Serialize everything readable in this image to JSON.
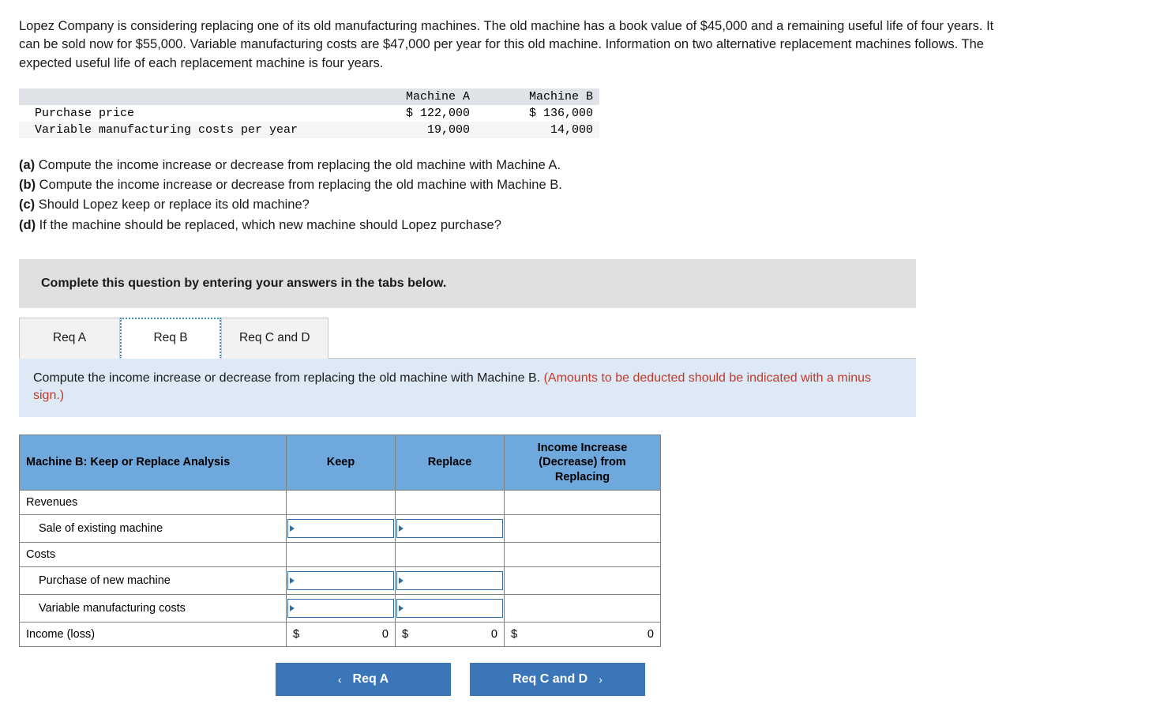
{
  "problem": {
    "text": "Lopez Company is considering replacing one of its old manufacturing machines. The old machine has a book value of $45,000 and a remaining useful life of four years. It can be sold now for $55,000. Variable manufacturing costs are $47,000 per year for this old machine. Information on two alternative replacement machines follows. The expected useful life of each replacement machine is four years."
  },
  "data_table": {
    "headers": [
      "",
      "Machine A",
      "Machine B"
    ],
    "rows": [
      {
        "label": "Purchase price",
        "machine_a": "$ 122,000",
        "machine_b": "$ 136,000"
      },
      {
        "label": "Variable manufacturing costs per year",
        "machine_a": "19,000",
        "machine_b": "14,000"
      }
    ]
  },
  "requirements": [
    {
      "letter": "(a)",
      "text": "Compute the income increase or decrease from replacing the old machine with Machine A."
    },
    {
      "letter": "(b)",
      "text": "Compute the income increase or decrease from replacing the old machine with Machine B."
    },
    {
      "letter": "(c)",
      "text": "Should Lopez keep or replace its old machine?"
    },
    {
      "letter": "(d)",
      "text": "If the machine should be replaced, which new machine should Lopez purchase?"
    }
  ],
  "banner": {
    "text": "Complete this question by entering your answers in the tabs below."
  },
  "tabs": [
    {
      "label": "Req A",
      "active": false
    },
    {
      "label": "Req B",
      "active": true
    },
    {
      "label": "Req C and D",
      "active": false
    }
  ],
  "instruction": {
    "main": "Compute the income increase or decrease from replacing the old machine with Machine B.",
    "note": "(Amounts to be deducted should be indicated with a minus sign.)"
  },
  "worksheet": {
    "headers": {
      "analysis": "Machine B: Keep or Replace Analysis",
      "keep": "Keep",
      "replace": "Replace",
      "income": "Income Increase (Decrease) from Replacing"
    },
    "rows": [
      {
        "label": "Revenues",
        "indent": false,
        "type": "section"
      },
      {
        "label": "Sale of existing machine",
        "indent": true,
        "type": "input"
      },
      {
        "label": "Costs",
        "indent": false,
        "type": "section"
      },
      {
        "label": "Purchase of new machine",
        "indent": true,
        "type": "input"
      },
      {
        "label": "Variable manufacturing costs",
        "indent": true,
        "type": "input"
      }
    ],
    "total_row": {
      "label": "Income (loss)",
      "keep_symbol": "$",
      "keep_value": "0",
      "replace_symbol": "$",
      "replace_value": "0",
      "income_symbol": "$",
      "income_value": "0"
    }
  },
  "nav": {
    "prev_label": "Req A",
    "prev_icon": "‹",
    "next_label": "Req C and D",
    "next_icon": "›"
  },
  "colors": {
    "header_blue": "#6fa8dc",
    "instruction_blue": "#ddeaf6",
    "banner_grey": "#e0e0e0",
    "button_blue": "#3b77b8",
    "note_red": "#c0392b"
  }
}
